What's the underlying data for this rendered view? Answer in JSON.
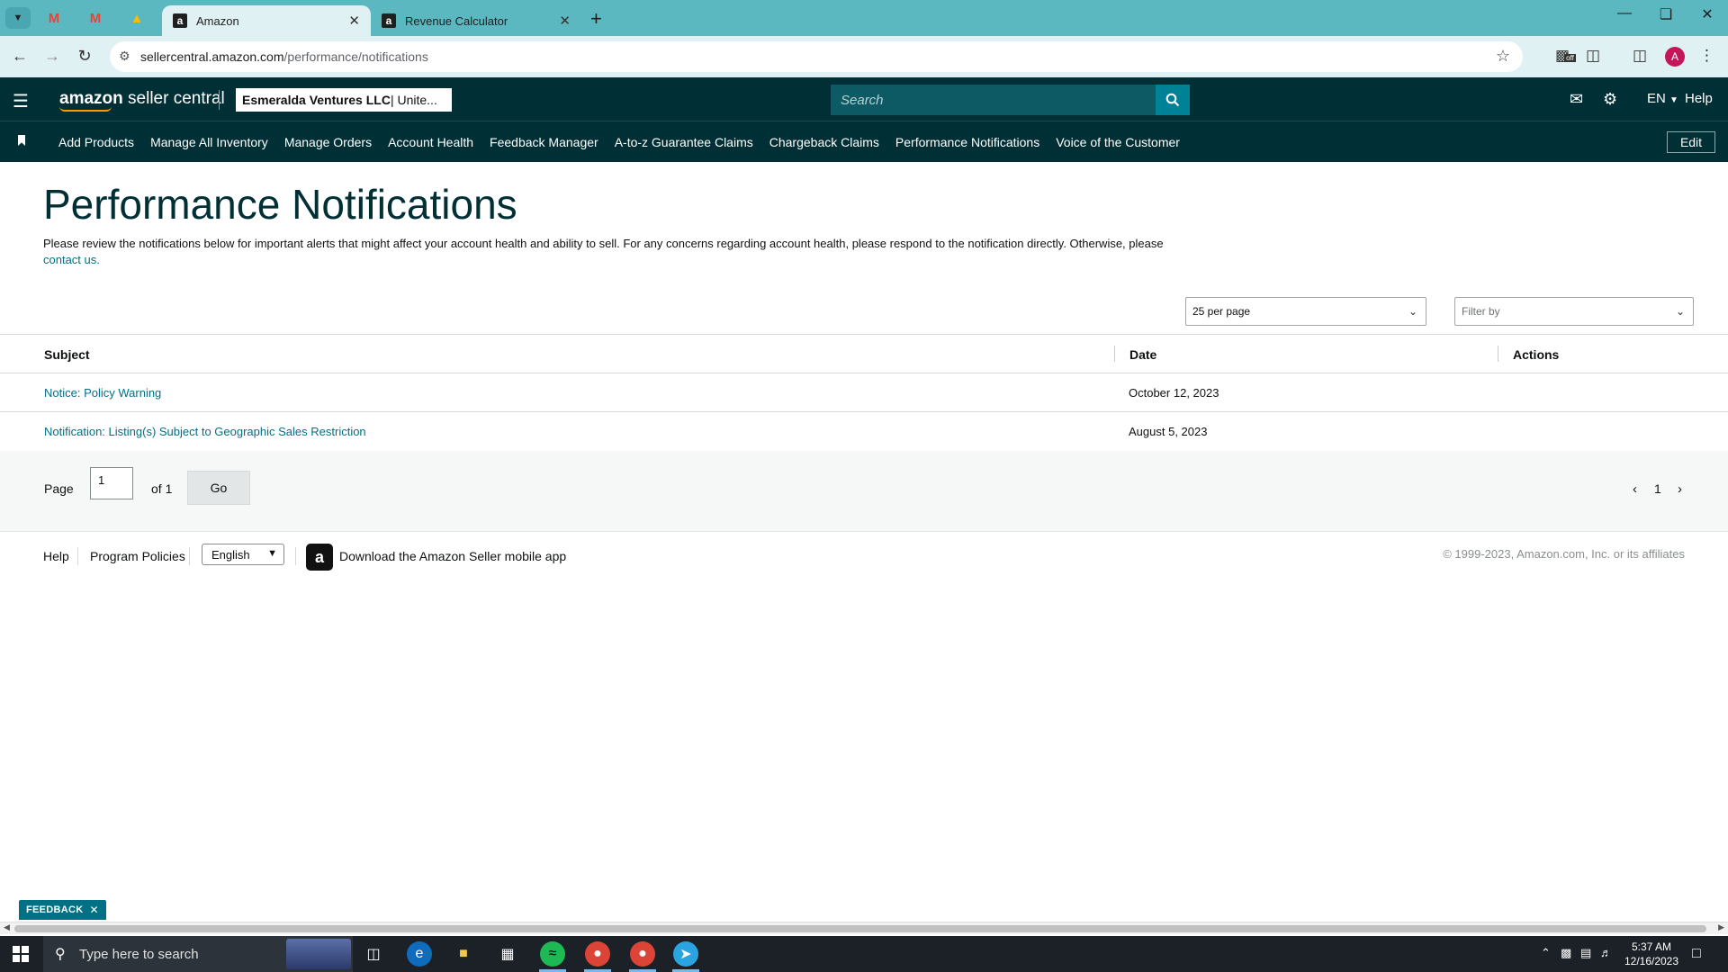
{
  "browser": {
    "tabs": [
      {
        "title": "Amazon",
        "active": true
      },
      {
        "title": "Revenue Calculator",
        "active": false
      }
    ],
    "url_host": "sellercentral.amazon.com",
    "url_path": "/performance/notifications",
    "profile_initial": "A",
    "extension_badge": "off"
  },
  "header": {
    "logo_primary": "amazon",
    "logo_secondary": " seller central",
    "account_name": "Esmeralda Ventures LLC",
    "account_region": " | Unite...",
    "search_placeholder": "Search",
    "language": "EN",
    "help": "Help"
  },
  "nav": {
    "links": [
      "Add Products",
      "Manage All Inventory",
      "Manage Orders",
      "Account Health",
      "Feedback Manager",
      "A-to-z Guarantee Claims",
      "Chargeback Claims",
      "Performance Notifications",
      "Voice of the Customer"
    ],
    "edit": "Edit"
  },
  "main": {
    "title": "Performance Notifications",
    "intro": "Please review the notifications below for important alerts that might affect your account health and ability to sell. For any concerns regarding account health, please respond to the notification directly. Otherwise, please ",
    "contact_link": "contact us.",
    "per_page": "25 per page",
    "filter_placeholder": "Filter by"
  },
  "table": {
    "headers": {
      "subject": "Subject",
      "date": "Date",
      "actions": "Actions"
    },
    "rows": [
      {
        "subject": "Notice: Policy Warning",
        "date": "October 12, 2023"
      },
      {
        "subject": "Notification: Listing(s) Subject to Geographic Sales Restriction",
        "date": "August 5, 2023"
      }
    ]
  },
  "pager": {
    "page_label": "Page",
    "page_value": "1",
    "of_label": "of 1",
    "go": "Go",
    "current": "1"
  },
  "footer": {
    "help": "Help",
    "policies": "Program Policies",
    "language": "English",
    "app_text": "Download the Amazon Seller mobile app",
    "copyright": "© 1999-2023, Amazon.com, Inc. or its affiliates"
  },
  "feedback": "FEEDBACK",
  "taskbar": {
    "search_placeholder": "Type here to search",
    "time": "5:37 AM",
    "date": "12/16/2023"
  },
  "colors": {
    "header_bg": "#002f36",
    "tabbar": "#5bb8c1",
    "link": "#007185",
    "accent_orange": "#ff9900"
  }
}
